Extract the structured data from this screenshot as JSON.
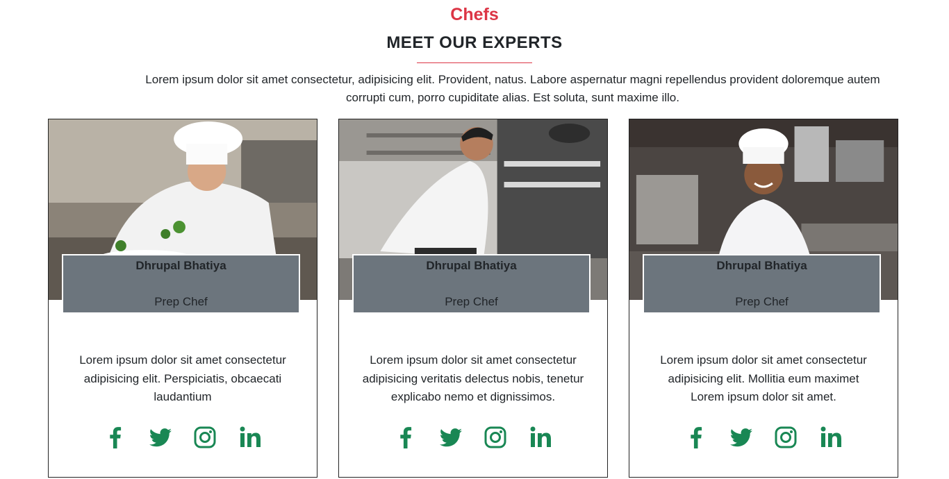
{
  "section": {
    "tag": "Chefs",
    "title": "MEET OUR EXPERTS",
    "intro": "Lorem ipsum dolor sit amet consectetur, adipisicing elit. Provident, natus. Labore aspernatur magni repellendus provident doloremque autem corrupti cum, porro cupiditate alias. Est soluta, sunt maxime illo."
  },
  "colors": {
    "accent": "#dc3545",
    "icon_green": "#198754",
    "namebox_gray": "#6c757d"
  },
  "chefs": [
    {
      "name": "Dhrupal Bhatiya",
      "role": "Prep Chef",
      "description": "Lorem ipsum dolor sit amet consectetur adipisicing elit. Perspiciatis, obcaecati laudantium",
      "image": "chef-plating-food-photo"
    },
    {
      "name": "Dhrupal Bhatiya",
      "role": "Prep Chef",
      "description": "Lorem ipsum dolor sit amet consectetur adipisicing veritatis delectus nobis, tenetur explicabo nemo et dignissimos.",
      "image": "chef-cooking-in-kitchen-photo"
    },
    {
      "name": "Dhrupal Bhatiya",
      "role": "Prep Chef",
      "description": "Lorem ipsum dolor sit amet consectetur adipisicing elit. Mollitia eum maximet Lorem ipsum dolor sit amet.",
      "image": "smiling-female-chef-photo"
    }
  ],
  "social_icons": [
    "facebook-icon",
    "twitter-icon",
    "instagram-icon",
    "linkedin-icon"
  ]
}
